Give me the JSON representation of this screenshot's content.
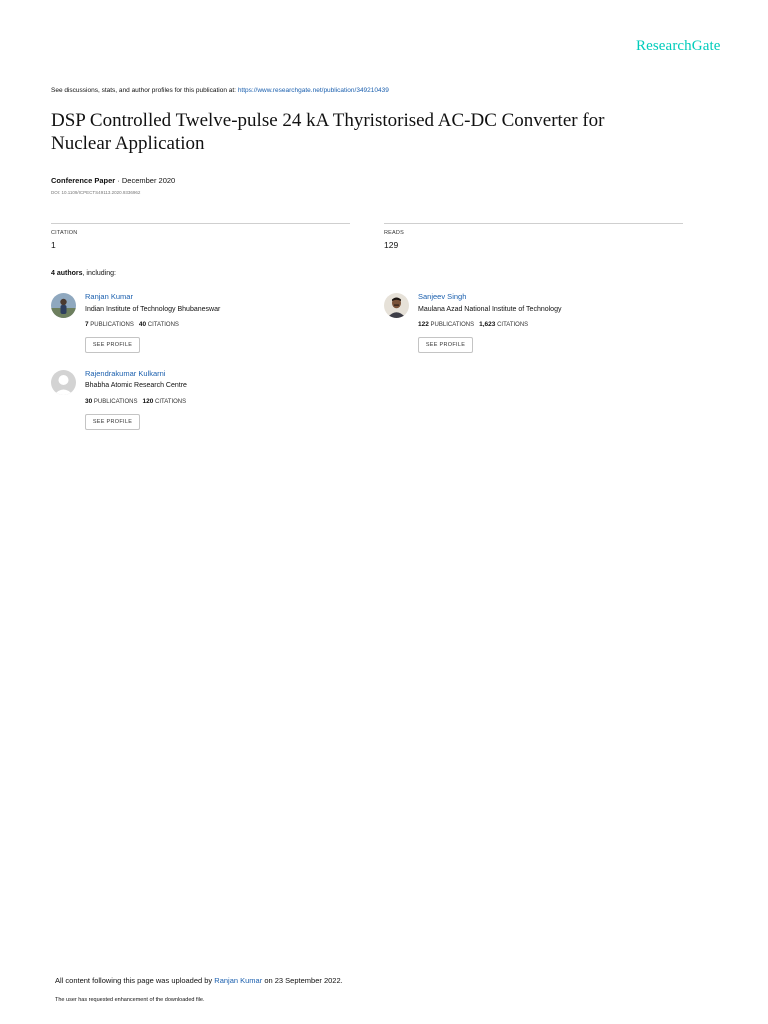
{
  "brand": "ResearchGate",
  "header": {
    "discuss_prefix": "See discussions, stats, and author profiles for this publication at:",
    "discuss_url": "https://www.researchgate.net/publication/349210439"
  },
  "title_lines": [
    "DSP Controlled Twelve-pulse 24 kA Thyristorised AC-DC Converter for",
    "Nuclear Application"
  ],
  "paper": {
    "type": "Conference Paper",
    "date": " · December 2020",
    "doi": "DOI: 10.1109/ICPECTS49113.2020.9336962"
  },
  "stats": {
    "citation_label": "CITATION",
    "citation_value": "1",
    "reads_label": "READS",
    "reads_value": "129"
  },
  "authors_heading": {
    "count": "4 authors",
    "suffix": ", including:"
  },
  "authors": [
    {
      "name": "Ranjan Kumar",
      "institution": "Indian Institute of Technology Bhubaneswar",
      "publications": "7",
      "citations": "40",
      "avatar": "photo"
    },
    {
      "name": "Sanjeev Singh",
      "institution": "Maulana Azad National Institute of Technology",
      "publications": "122",
      "citations": "1,623",
      "avatar": "photo"
    },
    {
      "name": "Rajendrakumar Kulkarni",
      "institution": "Bhabha Atomic Research Centre",
      "publications": "30",
      "citations": "120",
      "avatar": "placeholder"
    }
  ],
  "labels": {
    "publications": "PUBLICATIONS",
    "citations": "CITATIONS",
    "see_profile": "SEE PROFILE"
  },
  "footer": {
    "uploaded_prefix": "All content following this page was uploaded by",
    "uploader": "Ranjan Kumar",
    "uploaded_suffix": "on 23 September 2022.",
    "enhancement_note": "The user has requested enhancement of the downloaded file."
  },
  "colors": {
    "brand": "#00ccbb",
    "link": "#1a5fae"
  }
}
